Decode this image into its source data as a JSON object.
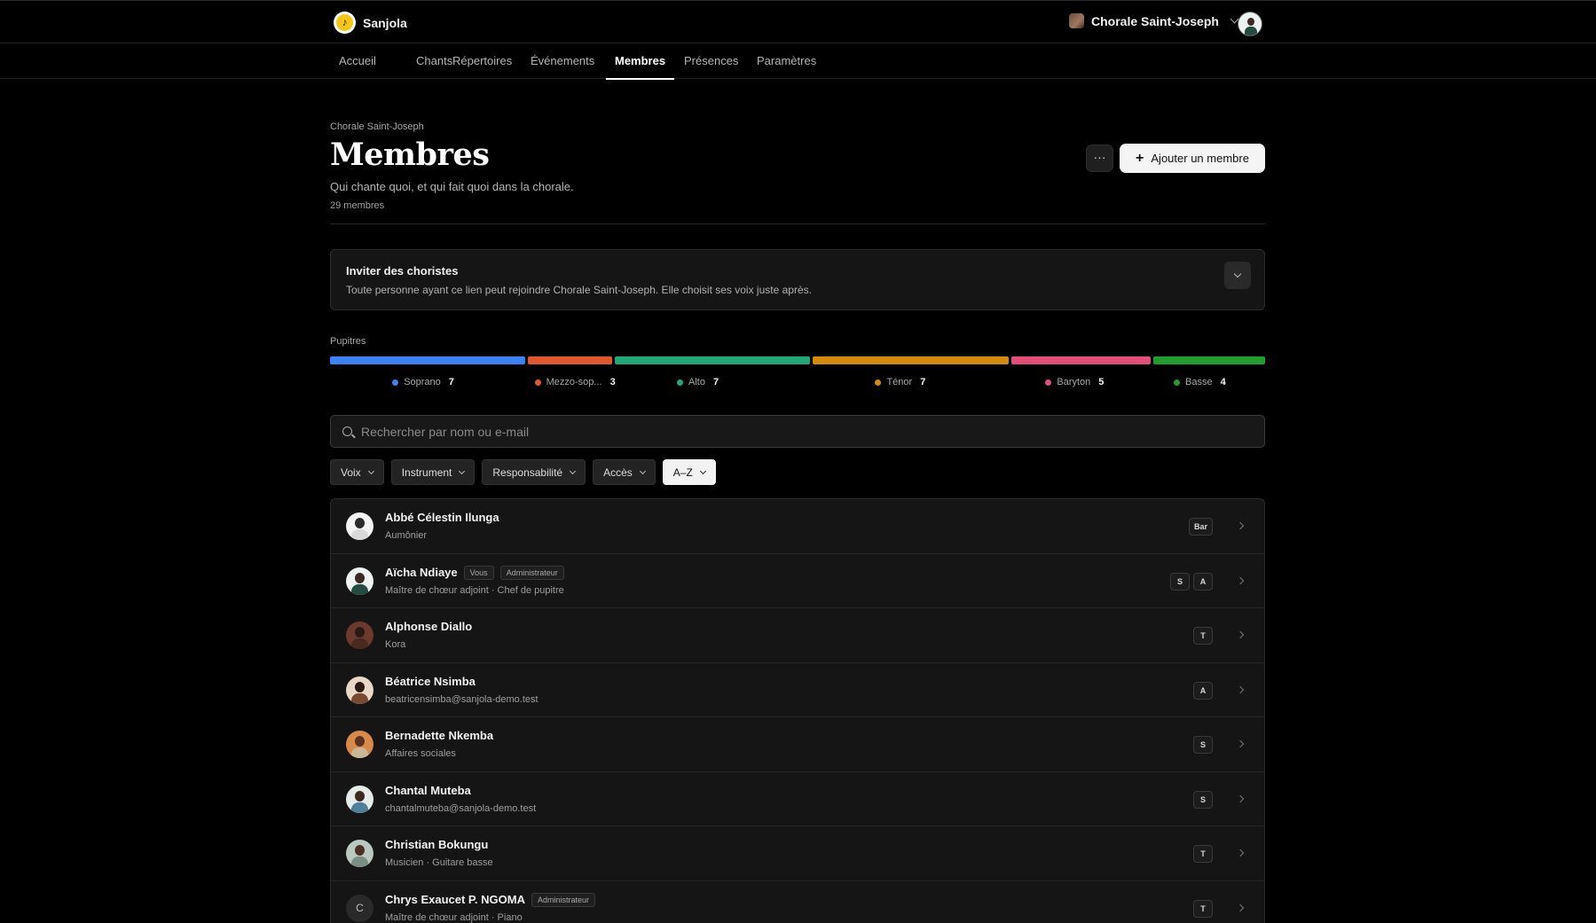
{
  "app": {
    "name": "Sanjola",
    "logo_icon": "music-note-icon"
  },
  "org": {
    "name": "Chorale Saint-Joseph"
  },
  "nav": [
    {
      "label": "Accueil",
      "active": false
    },
    {
      "label": "Chants",
      "active": false
    },
    {
      "label": "Répertoires",
      "active": false
    },
    {
      "label": "Événements",
      "active": false
    },
    {
      "label": "Membres",
      "active": true
    },
    {
      "label": "Présences",
      "active": false
    },
    {
      "label": "Paramètres",
      "active": false
    }
  ],
  "page": {
    "breadcrumb": "Chorale Saint-Joseph",
    "title": "Membres",
    "subtitle": "Qui chante quoi, et qui fait quoi dans la chorale.",
    "count": "29 membres",
    "more_label": "···",
    "add_label": "Ajouter un membre"
  },
  "invite": {
    "title": "Inviter des choristes",
    "description": "Toute personne ayant ce lien peut rejoindre Chorale Saint-Joseph. Elle choisit ses voix juste après."
  },
  "pupitres": {
    "label": "Pupitres",
    "voices": [
      {
        "name": "Soprano",
        "count": "7",
        "color": "#3b82f6"
      },
      {
        "name": "Mezzo-sop...",
        "count": "3",
        "color": "#e2572b"
      },
      {
        "name": "Alto",
        "count": "7",
        "color": "#1fa97a"
      },
      {
        "name": "Ténor",
        "count": "7",
        "color": "#d68a0c"
      },
      {
        "name": "Baryton",
        "count": "5",
        "color": "#e24d7a"
      },
      {
        "name": "Basse",
        "count": "4",
        "color": "#1f9e2e"
      }
    ]
  },
  "search": {
    "placeholder": "Rechercher par nom ou e-mail"
  },
  "filters": [
    {
      "label": "Voix",
      "active": false
    },
    {
      "label": "Instrument",
      "active": false
    },
    {
      "label": "Responsabilité",
      "active": false
    },
    {
      "label": "Accès",
      "active": false
    },
    {
      "label": "A–Z",
      "active": true
    }
  ],
  "members": [
    {
      "name": "Abbé Célestin Ilunga",
      "tags": [],
      "sub": "Aumônier",
      "badges": [
        "Bar"
      ],
      "avatar": {
        "bg": "#f3f3f3",
        "hair": "#2b2b2b",
        "cloth": "#d9d9d9"
      }
    },
    {
      "name": "Aïcha Ndiaye",
      "tags": [
        "Vous",
        "Administrateur"
      ],
      "sub": "Maître de chœur adjoint · Chef de pupitre",
      "badges": [
        "S",
        "A"
      ],
      "avatar": {
        "bg": "#eef3f2",
        "hair": "#3b2a22",
        "cloth": "#234b42"
      }
    },
    {
      "name": "Alphonse Diallo",
      "tags": [],
      "sub": "Kora",
      "badges": [
        "T"
      ],
      "avatar": {
        "bg": "#6b3a2c",
        "hair": "#2a1a14",
        "cloth": "#4a2a20"
      }
    },
    {
      "name": "Béatrice Nsimba",
      "tags": [],
      "sub": "beatricensimba@sanjola-demo.test",
      "badges": [
        "A"
      ],
      "avatar": {
        "bg": "#e9d8c8",
        "hair": "#2a1a12",
        "cloth": "#7a4a30"
      }
    },
    {
      "name": "Bernadette Nkemba",
      "tags": [],
      "sub": "Affaires sociales",
      "badges": [
        "S"
      ],
      "avatar": {
        "bg": "#d88a4a",
        "hair": "#5a3320",
        "cloth": "#c9b79a"
      }
    },
    {
      "name": "Chantal Muteba",
      "tags": [],
      "sub": "chantalmuteba@sanjola-demo.test",
      "badges": [
        "S"
      ],
      "avatar": {
        "bg": "#e6ece9",
        "hair": "#3a2a20",
        "cloth": "#4f7f9a"
      }
    },
    {
      "name": "Christian Bokungu",
      "tags": [],
      "sub": "Musicien · Guitare basse",
      "badges": [
        "T"
      ],
      "avatar": {
        "bg": "#b9c9c0",
        "hair": "#4a3022",
        "cloth": "#7a8f84"
      }
    },
    {
      "name": "Chrys Exaucet P. NGOMA",
      "tags": [
        "Administrateur"
      ],
      "sub": "Maître de chœur adjoint · Piano",
      "badges": [
        "T"
      ],
      "initial": "C"
    }
  ]
}
